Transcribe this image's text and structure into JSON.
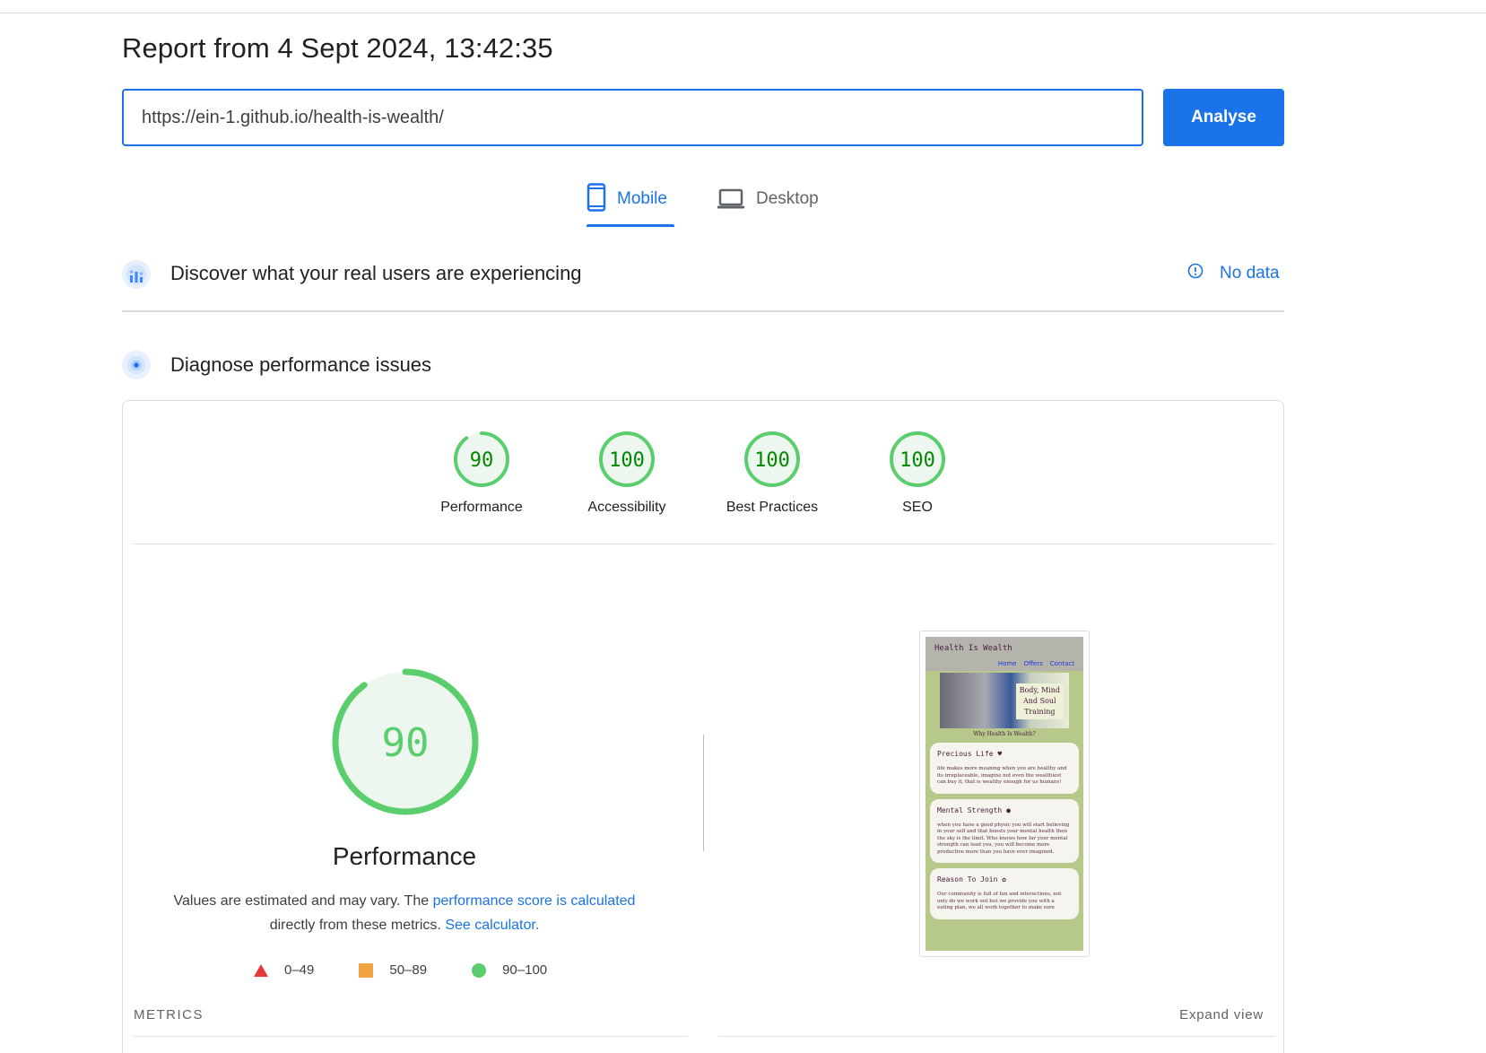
{
  "report": {
    "title": "Report from 4 Sept 2024, 13:42:35"
  },
  "url_input": {
    "value": "https://ein-1.github.io/health-is-wealth/"
  },
  "analyse_label": "Analyse",
  "tabs": [
    {
      "label": "Mobile",
      "icon": "mobile-phone-icon",
      "selected": true
    },
    {
      "label": "Desktop",
      "icon": "laptop-icon",
      "selected": false
    }
  ],
  "field_data": {
    "title": "Discover what your real users are experiencing",
    "status": "No data",
    "icon": "crux-users-icon"
  },
  "lab_data": {
    "title": "Diagnose performance issues",
    "icon": "lighthouse-icon"
  },
  "scores": [
    {
      "label": "Performance",
      "value": "90"
    },
    {
      "label": "Accessibility",
      "value": "100"
    },
    {
      "label": "Best Practices",
      "value": "100"
    },
    {
      "label": "SEO",
      "value": "100"
    }
  ],
  "performance": {
    "score": "90",
    "title": "Performance",
    "desc_pre": "Values are estimated and may vary. The ",
    "desc_link1": "performance score is calculated",
    "desc_mid": " directly from these metrics. ",
    "desc_link2": "See calculator.",
    "legend": [
      {
        "range": "0–49",
        "color": "#e53935",
        "shape": "triangle"
      },
      {
        "range": "50–89",
        "color": "#f2a343",
        "shape": "square"
      },
      {
        "range": "90–100",
        "color": "#5acd6d",
        "shape": "circle"
      }
    ]
  },
  "metrics_label": "METRICS",
  "expand_label": "Expand view",
  "colors": {
    "accent": "#1a73e8",
    "pass": "#5acd6d",
    "pass_text": "#008800"
  },
  "thumbnail": {
    "site_title": "Health Is Wealth",
    "nav": [
      "Home",
      "Offers",
      "Contact"
    ],
    "hero_text": [
      "Body, Mind",
      "And Soul",
      "Training"
    ],
    "why": "Why Health Is Wealth?",
    "cards": [
      {
        "title": "Precious Life ♥",
        "text": "life makes more meaning when you are healthy and its irreplaceable, imagine not even the wealthiest can buy it, that is wealthy enough for us humans!"
      },
      {
        "title": "Mental Strength ●",
        "text": "when you have a good physic you will start believing in your self and that boosts your mental health then the sky is the limit. Who knows how far your mental strength can lead you, you will become more productive more than you have ever imagined."
      },
      {
        "title": "Reason To Join ✿",
        "text": "Our community is full of fun and interactions, not only do we work out but we provide you with a eating plan, we all work together to make sure"
      }
    ]
  }
}
